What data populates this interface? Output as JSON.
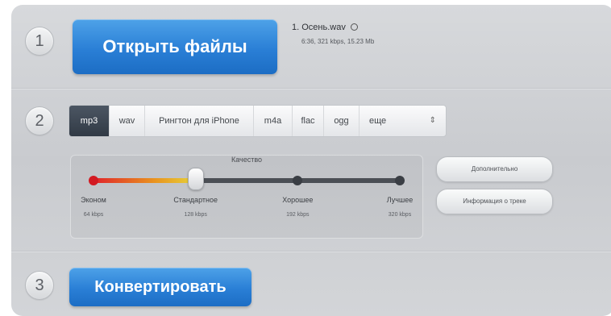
{
  "steps": [
    "1",
    "2",
    "3"
  ],
  "open_button": {
    "label": "Открыть файлы"
  },
  "file": {
    "name": "1. Осень.wav",
    "meta": "6:36, 321 kbps, 15.23 Mb",
    "remove_icon": "circle-icon"
  },
  "formats": {
    "items": [
      "mp3",
      "wav",
      "Рингтон для iPhone",
      "m4a",
      "flac",
      "ogg"
    ],
    "active": "mp3",
    "more": {
      "label": "еще",
      "icon": "up-down-arrows-icon"
    }
  },
  "quality": {
    "title": "Качество",
    "selected_index": 1,
    "levels": [
      {
        "name": "Эконом",
        "rate": "64 kbps"
      },
      {
        "name": "Стандартное",
        "rate": "128 kbps"
      },
      {
        "name": "Хорошее",
        "rate": "192 kbps"
      },
      {
        "name": "Лучшее",
        "rate": "320 kbps"
      }
    ]
  },
  "side_buttons": {
    "advanced": "Дополнительно",
    "track_info": "Информация о треке"
  },
  "convert_button": {
    "label": "Конвертировать"
  },
  "colors": {
    "accent_blue": "#2a7fd6",
    "active_tab": "#3a434f",
    "slider_red": "#e0242b",
    "slider_yellow": "#e6d33a"
  }
}
